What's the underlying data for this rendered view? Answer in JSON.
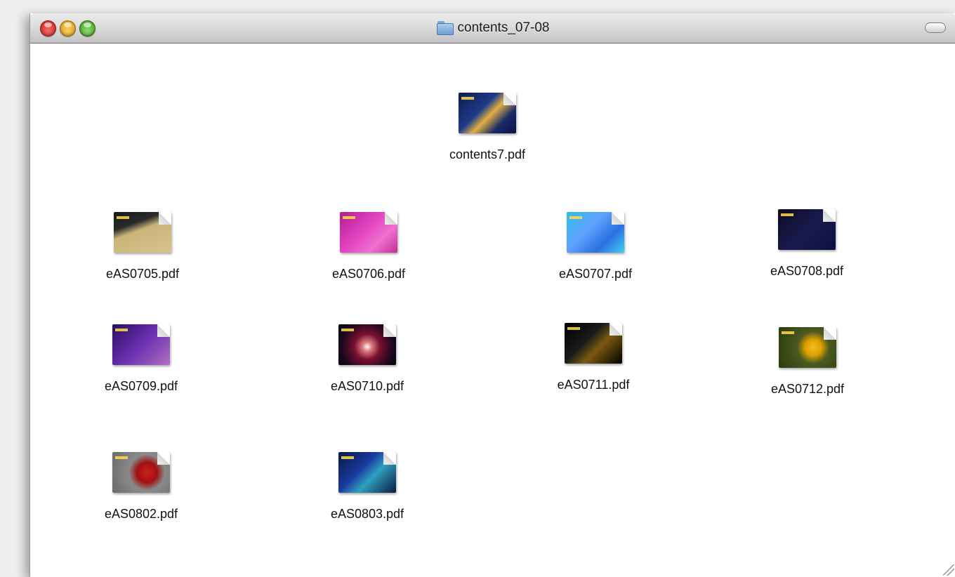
{
  "window": {
    "title": "contents_07-08",
    "title_icon": "folder-icon"
  },
  "files": [
    {
      "id": "contents7",
      "name": "contents7.pdf",
      "icon": "pdf-document-icon",
      "thumb": "linear-gradient(135deg,#0d1b4a 0%,#1d3a8a 40%,#e0b040 55%,#1a2a6a 75%,#0a1540 100%)"
    },
    {
      "id": "eAS0705",
      "name": "eAS0705.pdf",
      "icon": "pdf-document-icon",
      "thumb": "linear-gradient(160deg,#1a1a1a 0%,#2a2a2a 30%,#c9b47a 45%,#d8c48a 100%)"
    },
    {
      "id": "eAS0706",
      "name": "eAS0706.pdf",
      "icon": "pdf-document-icon",
      "thumb": "linear-gradient(135deg,#b0208a 0%,#e040c0 40%,#f070d0 70%,#c03090 100%)"
    },
    {
      "id": "eAS0707",
      "name": "eAS0707.pdf",
      "icon": "pdf-document-icon",
      "thumb": "linear-gradient(135deg,#30c0e0 0%,#60a0ff 40%,#2a70e0 70%,#40d0f0 100%)"
    },
    {
      "id": "eAS0708",
      "name": "eAS0708.pdf",
      "icon": "pdf-document-icon",
      "thumb": "linear-gradient(135deg,#0a0a20 0%,#1a1a50 50%,#0a1040 100%)"
    },
    {
      "id": "eAS0709",
      "name": "eAS0709.pdf",
      "icon": "pdf-document-icon",
      "thumb": "linear-gradient(135deg,#2a1060 0%,#6a30b0 50%,#b070c0 100%)"
    },
    {
      "id": "eAS0710",
      "name": "eAS0710.pdf",
      "icon": "pdf-document-icon",
      "thumb": "radial-gradient(circle at 50% 55%,#ffffff 0%,#e08080 12%,#7a1030 35%,#1a0820 70%,#050510 100%)"
    },
    {
      "id": "eAS0711",
      "name": "eAS0711.pdf",
      "icon": "pdf-document-icon",
      "thumb": "linear-gradient(135deg,#000000 0%,#1a1a1a 40%,#7a5a10 60%,#000000 100%)"
    },
    {
      "id": "eAS0712",
      "name": "eAS0712.pdf",
      "icon": "pdf-document-icon",
      "thumb": "radial-gradient(circle at 60% 50%,#f0c020 0%,#e0a000 20%,#4a5a20 40%,#2a3a10 100%)"
    },
    {
      "id": "eAS0802",
      "name": "eAS0802.pdf",
      "icon": "pdf-document-icon",
      "thumb": "radial-gradient(circle at 60% 50%,#d02020 0%,#a01010 25%,#8a8a8a 45%,#6a6a6a 100%)"
    },
    {
      "id": "eAS0803",
      "name": "eAS0803.pdf",
      "icon": "pdf-document-icon",
      "thumb": "linear-gradient(135deg,#0a1a40 0%,#1a3aa0 40%,#30a0c0 60%,#0a1a40 100%)"
    }
  ]
}
